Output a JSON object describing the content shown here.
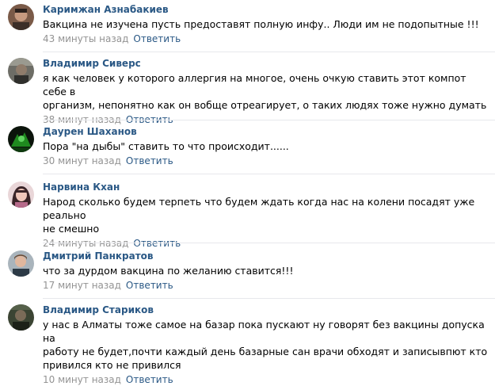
{
  "reply_label": "Ответить",
  "comments": [
    {
      "author": "Каримжан Азнабакиев",
      "text": "Вакцина не изучена пусть предоставят полную инфу.. Люди им не подопытные !!!",
      "time": "43 минуты назад"
    },
    {
      "author": "Владимир Сиверс",
      "text": "я как человек у которого аллергия на многое, очень очкую ставить этот компот себе в\nорганизм, непонятно как он вобще отреагирует, о таких людях тоже нужно думать",
      "time": "38 минут назад"
    },
    {
      "author": "Даурен Шаханов",
      "text": "Пора \"на дыбы\" ставить то что происходит......",
      "time": "30 минут назад"
    },
    {
      "author": "Нарвина Кхан",
      "text": "Народ сколько будем терпеть что будем ждать когда нас на колени посадят уже реально\nне смешно",
      "time": "24 минуты назад"
    },
    {
      "author": "Дмитрий Панкратов",
      "text": "что за дурдом вакцина по желанию ставится!!!",
      "time": "17 минут назад"
    },
    {
      "author": "Владимир Стариков",
      "text": "у нас в Алматы тоже самое на базар пока пускают ну говорят без вакцины допуска на\nработу не будет,почти каждый день базарные сан врачи обходят и записывпют кто\nпривился кто не привился",
      "time": "10 минут назад"
    }
  ]
}
